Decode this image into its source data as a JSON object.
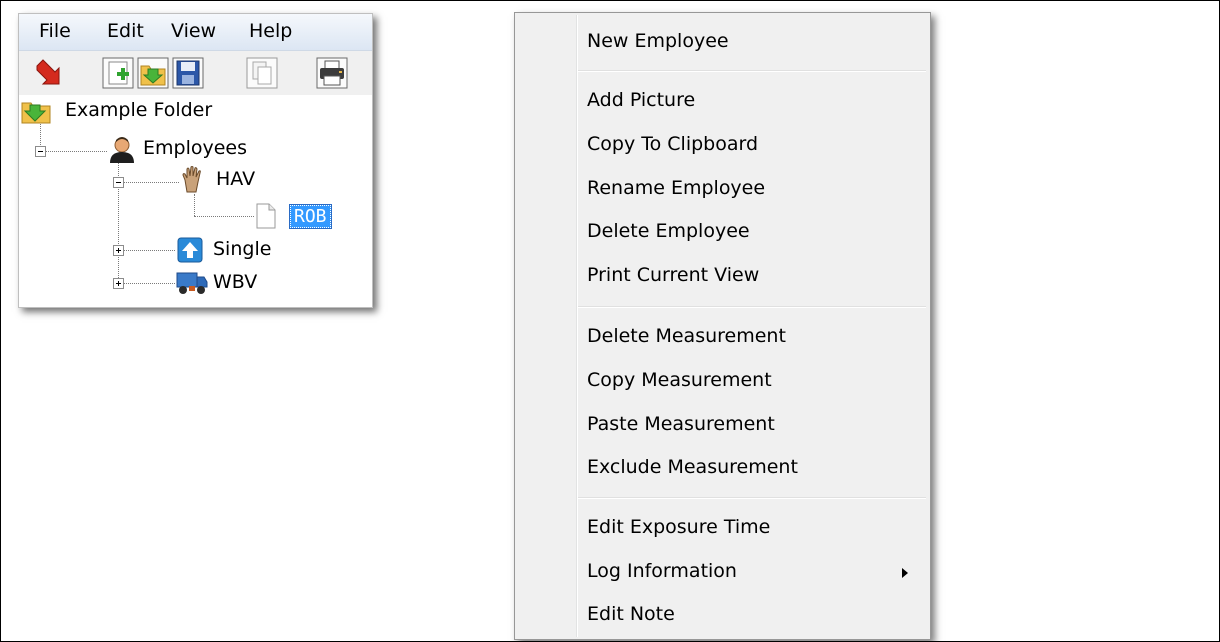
{
  "menubar": {
    "file": "File",
    "edit": "Edit",
    "view": "View",
    "help": "Help"
  },
  "toolbar": {
    "buttons": [
      {
        "icon": "exit-icon"
      },
      {
        "icon": "new-icon"
      },
      {
        "icon": "open-folder-icon"
      },
      {
        "icon": "save-icon"
      },
      {
        "icon": "copy-icon"
      },
      {
        "icon": "print-icon"
      }
    ]
  },
  "tree": {
    "root": "Example Folder",
    "employees": "Employees",
    "hav": "HAV",
    "rob": "ROB",
    "single": "Single",
    "wbv": "WBV"
  },
  "context_menu": {
    "new_employee": "New Employee",
    "add_picture": "Add Picture",
    "copy_to_clipboard": "Copy To Clipboard",
    "rename_employee": "Rename Employee",
    "delete_employee": "Delete Employee",
    "print_current_view": "Print Current View",
    "delete_measurement": "Delete Measurement",
    "copy_measurement": "Copy Measurement",
    "paste_measurement": "Paste Measurement",
    "exclude_measurement": "Exclude Measurement",
    "edit_exposure_time": "Edit Exposure Time",
    "log_information": "Log Information",
    "edit_note": "Edit Note"
  },
  "colors": {
    "selection": "#3399ff",
    "menu_background": "#f0f0f0",
    "menubar_gradient_top": "#f5f8fc",
    "menubar_gradient_bottom": "#dce6f3"
  }
}
